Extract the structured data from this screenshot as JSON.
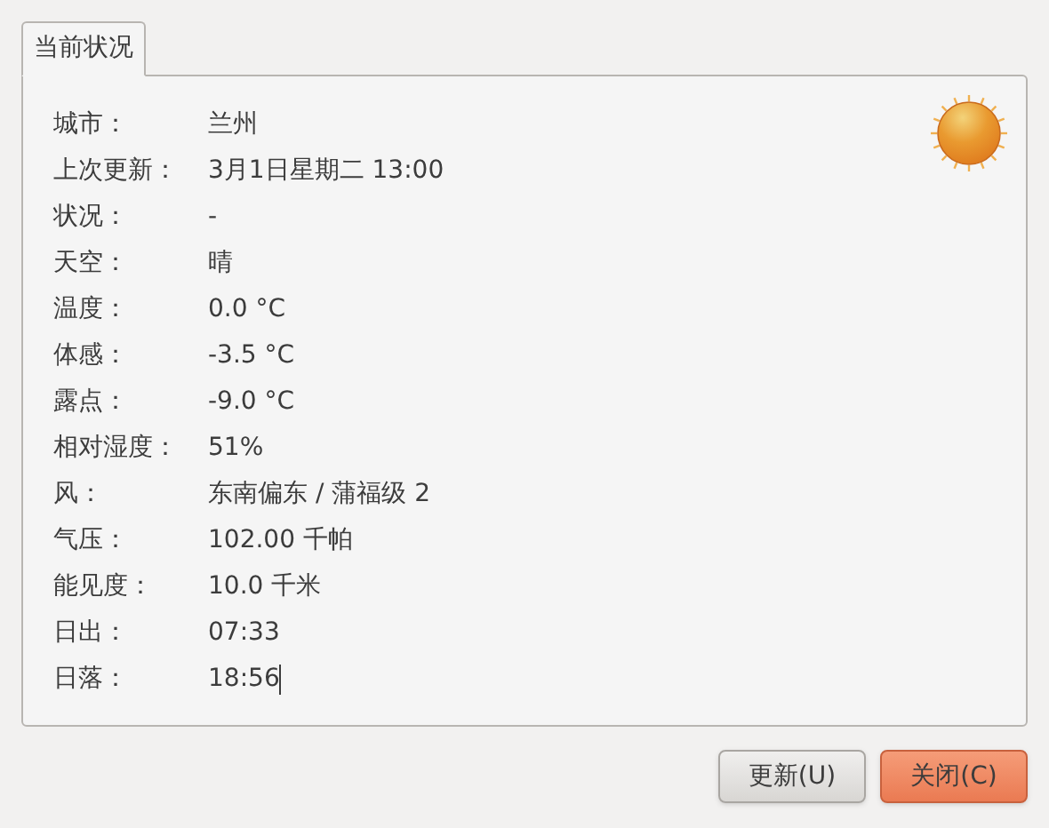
{
  "tabs": [
    {
      "label": "当前状况",
      "selected": true
    }
  ],
  "rows": [
    {
      "label": "城市：",
      "value": "兰州"
    },
    {
      "label": "上次更新：",
      "value": "3月1日星期二 13:00"
    },
    {
      "label": "状况：",
      "value": "-"
    },
    {
      "label": "天空：",
      "value": "晴"
    },
    {
      "label": "温度：",
      "value": "0.0 °C"
    },
    {
      "label": "体感：",
      "value": "-3.5 °C"
    },
    {
      "label": "露点：",
      "value": "-9.0 °C"
    },
    {
      "label": "相对湿度：",
      "value": "51%"
    },
    {
      "label": "风：",
      "value": "东南偏东 / 蒲福级 2"
    },
    {
      "label": "气压：",
      "value": "102.00 千帕"
    },
    {
      "label": "能见度：",
      "value": "10.0 千米"
    },
    {
      "label": "日出：",
      "value": "07:33"
    },
    {
      "label": "日落：",
      "value": "18:56"
    }
  ],
  "buttons": [
    {
      "label": "更新(U)",
      "kind": "normal"
    },
    {
      "label": "关闭(C)",
      "kind": "default"
    }
  ]
}
